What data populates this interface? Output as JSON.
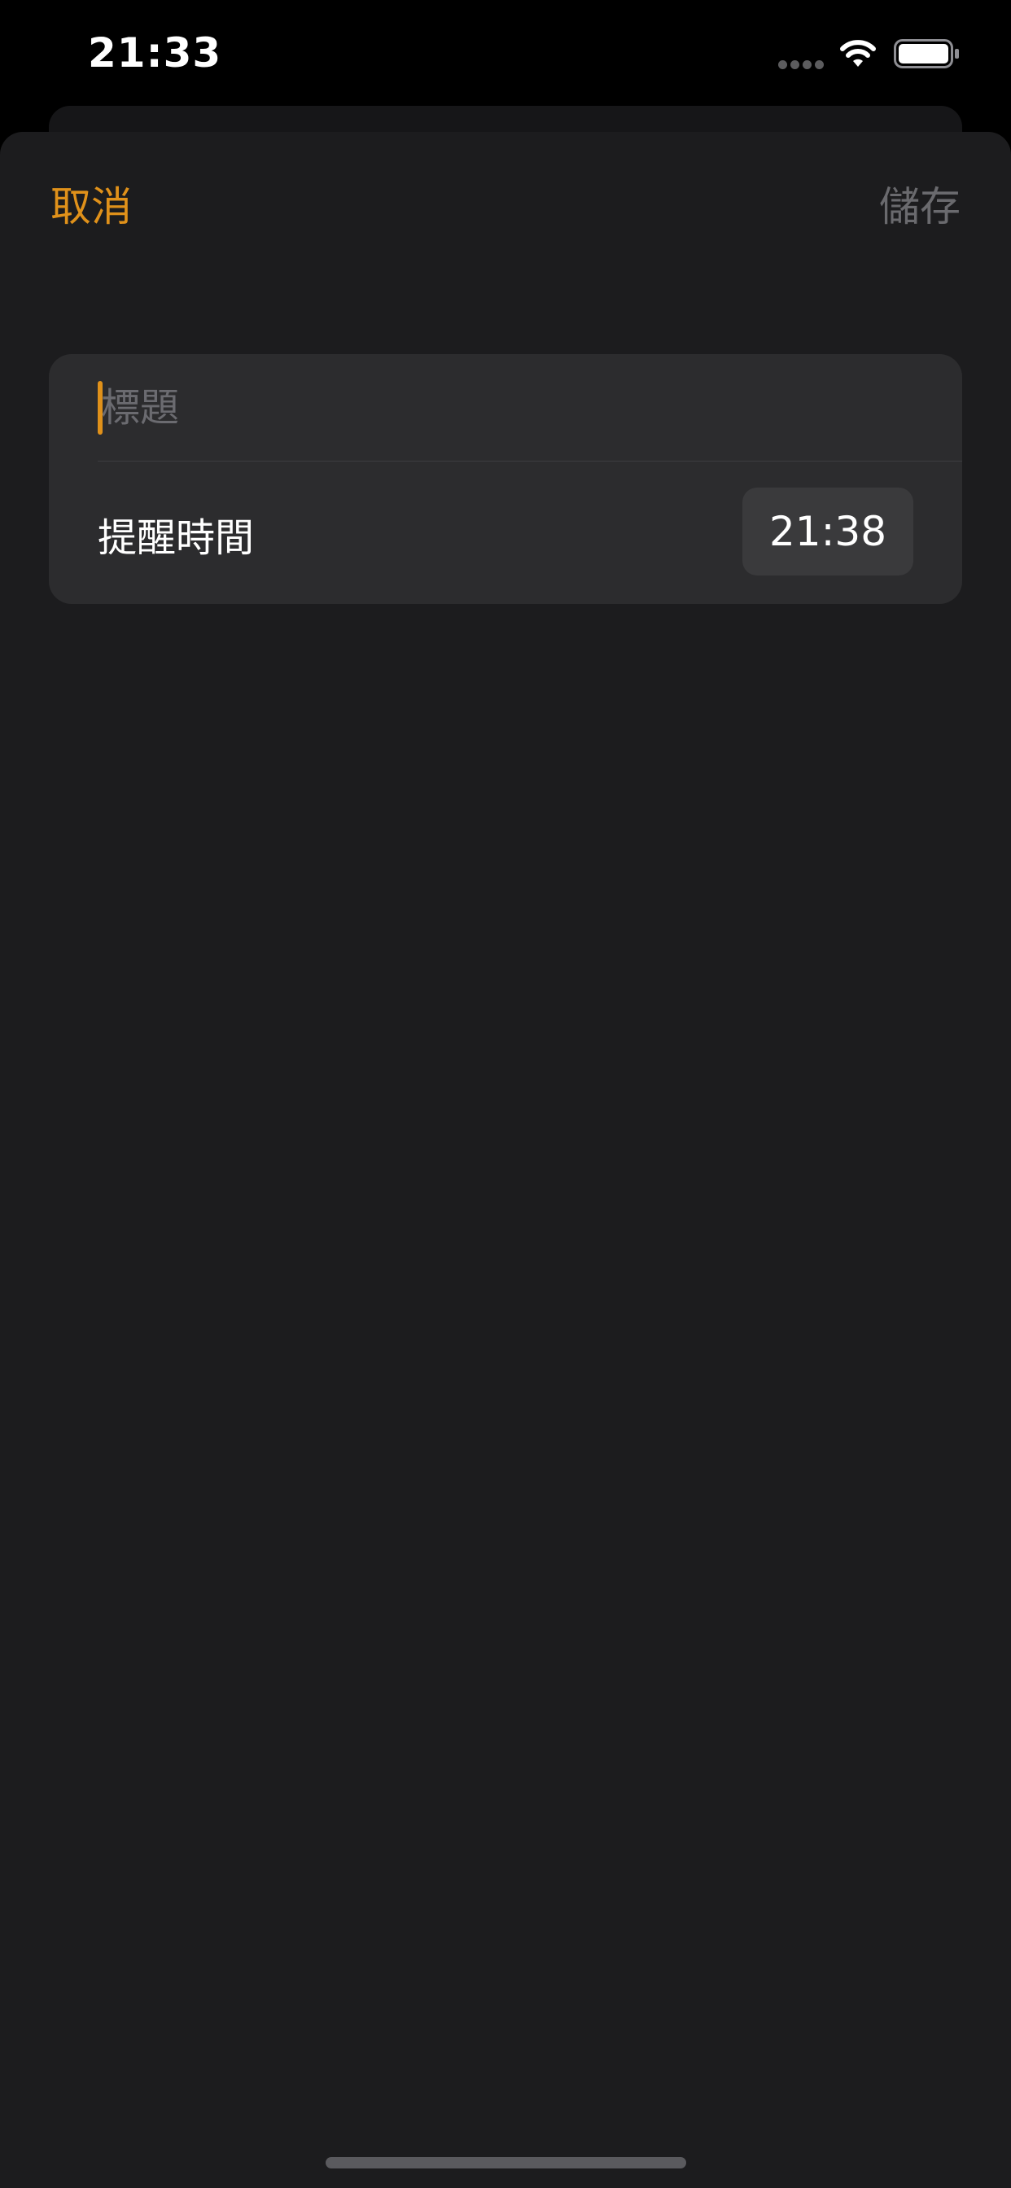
{
  "status_bar": {
    "time": "21:33",
    "icons": [
      "cellular-dots-icon",
      "wifi-icon",
      "battery-icon"
    ]
  },
  "nav": {
    "cancel_label": "取消",
    "save_label": "儲存"
  },
  "form": {
    "title_placeholder": "標題",
    "title_value": "",
    "reminder_label": "提醒時間",
    "reminder_time": "21:38"
  },
  "colors": {
    "accent": "#e0911a",
    "sheet_background": "#1c1c1e",
    "group_background": "#2c2c2e",
    "disabled_text": "#6a6a6e"
  }
}
